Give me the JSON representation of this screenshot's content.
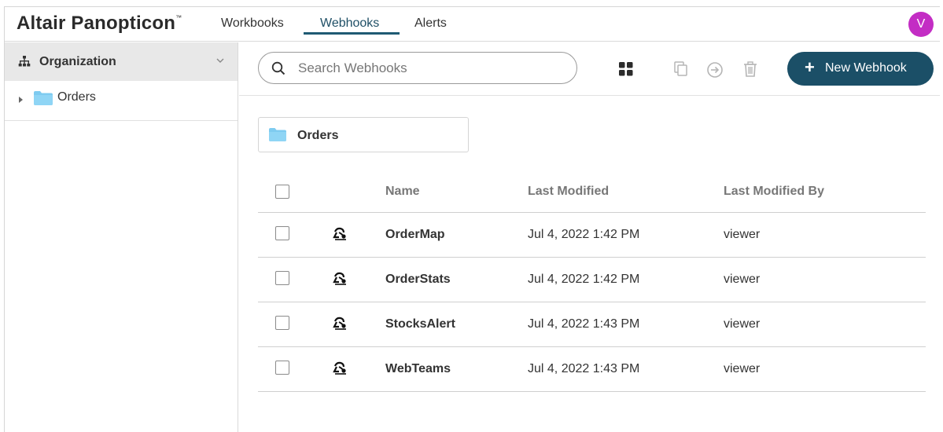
{
  "header": {
    "brand": "Altair Panopticon",
    "brand_mark": "™",
    "tabs": [
      {
        "label": "Workbooks"
      },
      {
        "label": "Webhooks"
      },
      {
        "label": "Alerts"
      }
    ],
    "active_tab": "Webhooks",
    "avatar_initial": "V",
    "avatar_color": "#c32dc4"
  },
  "sidebar": {
    "header_label": "Organization",
    "tree": [
      {
        "label": "Orders"
      }
    ]
  },
  "toolbar": {
    "search_placeholder": "Search Webhooks",
    "new_button_label": "New Webhook",
    "accent_color": "#1b4f67"
  },
  "folder_card": {
    "label": "Orders"
  },
  "table": {
    "columns": [
      "Name",
      "Last Modified",
      "Last Modified By"
    ],
    "rows": [
      {
        "name": "OrderMap",
        "modified": "Jul 4, 2022 1:42 PM",
        "by": "viewer"
      },
      {
        "name": "OrderStats",
        "modified": "Jul 4, 2022 1:42 PM",
        "by": "viewer"
      },
      {
        "name": "StocksAlert",
        "modified": "Jul 4, 2022 1:43 PM",
        "by": "viewer"
      },
      {
        "name": "WebTeams",
        "modified": "Jul 4, 2022 1:43 PM",
        "by": "viewer"
      }
    ]
  }
}
